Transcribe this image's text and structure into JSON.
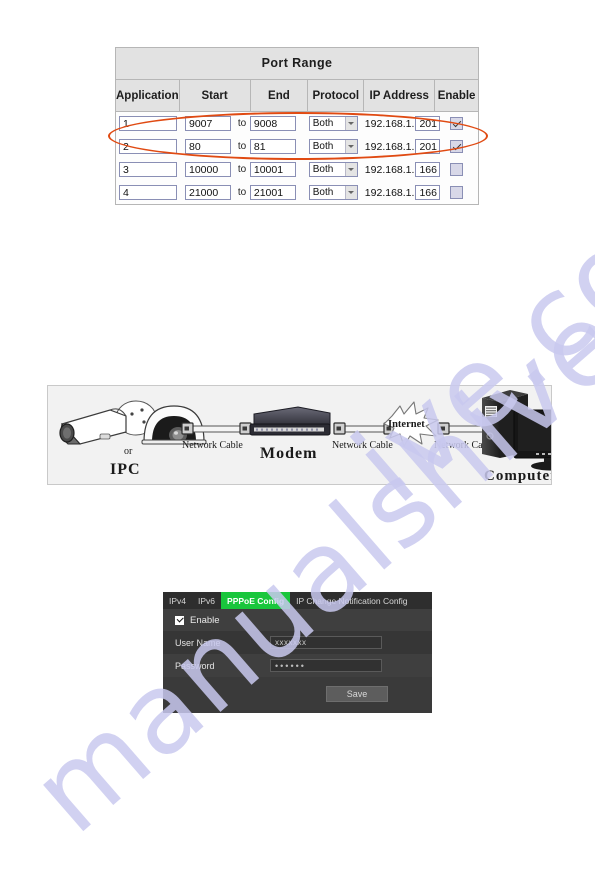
{
  "watermark": {
    "line1": "manualshive",
    "line2": "ive.com"
  },
  "port_range": {
    "title": "Port Range",
    "columns": [
      "Application",
      "Start",
      "End",
      "Protocol",
      "IP Address",
      "Enable"
    ],
    "to_label": "to",
    "rows": [
      {
        "application": "1",
        "start": "9007",
        "end": "9008",
        "protocol": "Both",
        "ip_prefix": "192.168.1.",
        "ip_suffix": "201",
        "enabled": true
      },
      {
        "application": "2",
        "start": "80",
        "end": "81",
        "protocol": "Both",
        "ip_prefix": "192.168.1.",
        "ip_suffix": "201",
        "enabled": true
      },
      {
        "application": "3",
        "start": "10000",
        "end": "10001",
        "protocol": "Both",
        "ip_prefix": "192.168.1.",
        "ip_suffix": "166",
        "enabled": false
      },
      {
        "application": "4",
        "start": "21000",
        "end": "21001",
        "protocol": "Both",
        "ip_prefix": "192.168.1.",
        "ip_suffix": "166",
        "enabled": false
      }
    ],
    "annotation_color": "#e04a12"
  },
  "network_diagram": {
    "ipc_label": "IPC",
    "or_label": "or",
    "cable1_label": "Network Cable",
    "modem_label": "Modem",
    "cable2_label": "Network Cable",
    "internet_label": "Internet",
    "cable3_label": "Network Cable",
    "computer_label": "Computer"
  },
  "pppoe": {
    "tabs": [
      {
        "label": "IPv4",
        "active": false
      },
      {
        "label": "IPv6",
        "active": false
      },
      {
        "label": "PPPoE Config",
        "active": true
      },
      {
        "label": "IP Change Notification Config",
        "active": false
      }
    ],
    "active_tab_color": "#19c63c",
    "enable_label": "Enable",
    "enable_checked": true,
    "username_label": "User Name",
    "username_value": "xxxxxxx",
    "password_label": "Password",
    "password_value": "••••••",
    "save_label": "Save"
  }
}
